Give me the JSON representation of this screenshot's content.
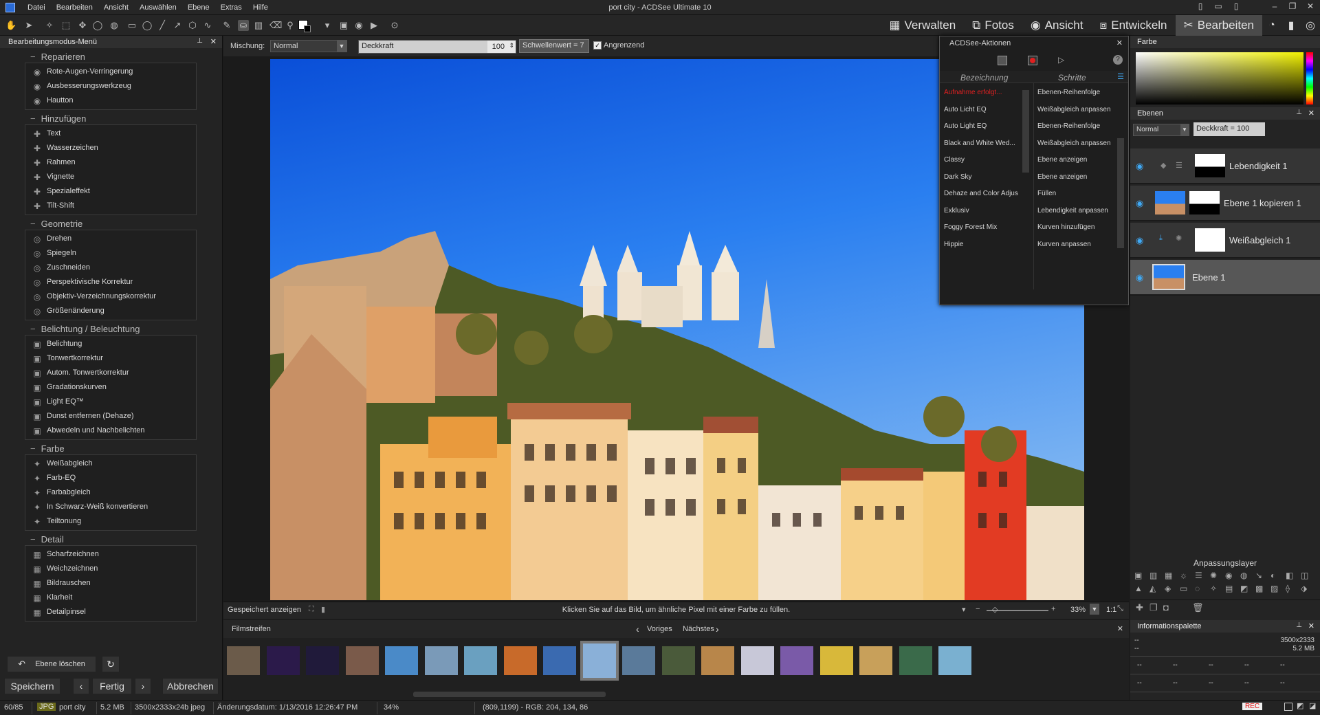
{
  "window": {
    "title": "port city - ACDSee Ultimate 10",
    "menu": [
      "Datei",
      "Bearbeiten",
      "Ansicht",
      "Auswählen",
      "Ebene",
      "Extras",
      "Hilfe"
    ]
  },
  "modes": [
    {
      "label": "Verwalten",
      "icon": "grid-icon"
    },
    {
      "label": "Fotos",
      "icon": "photos-icon"
    },
    {
      "label": "Ansicht",
      "icon": "eye-icon"
    },
    {
      "label": "Entwickeln",
      "icon": "develop-icon"
    },
    {
      "label": "Bearbeiten",
      "icon": "edit-icon",
      "active": true
    }
  ],
  "left_panel": {
    "title": "Bearbeitungsmodus-Menü",
    "groups": [
      {
        "title": "Reparieren",
        "items": [
          "Rote-Augen-Verringerung",
          "Ausbesserungswerkzeug",
          "Hautton"
        ]
      },
      {
        "title": "Hinzufügen",
        "items": [
          "Text",
          "Wasserzeichen",
          "Rahmen",
          "Vignette",
          "Spezialeffekt",
          "Tilt-Shift"
        ]
      },
      {
        "title": "Geometrie",
        "items": [
          "Drehen",
          "Spiegeln",
          "Zuschneiden",
          "Perspektivische Korrektur",
          "Objektiv-Verzeichnungskorrektur",
          "Größenänderung"
        ]
      },
      {
        "title": "Belichtung / Beleuchtung",
        "items": [
          "Belichtung",
          "Tonwertkorrektur",
          "Autom. Tonwertkorrektur",
          "Gradationskurven",
          "Light EQ™",
          "Dunst entfernen (Dehaze)",
          "Abwedeln und Nachbelichten"
        ]
      },
      {
        "title": "Farbe",
        "items": [
          "Weißabgleich",
          "Farb-EQ",
          "Farbabgleich",
          "In Schwarz-Weiß konvertieren",
          "Teiltonung"
        ]
      },
      {
        "title": "Detail",
        "items": [
          "Scharfzeichnen",
          "Weichzeichnen",
          "Bildrauschen",
          "Klarheit",
          "Detailpinsel"
        ]
      }
    ],
    "delete_layer": "Ebene löschen",
    "save": "Speichern",
    "done": "Fertig",
    "cancel": "Abbrechen"
  },
  "options": {
    "blend_label": "Mischung:",
    "blend_value": "Normal",
    "opacity_label": "Deckkraft",
    "opacity_value": "100",
    "threshold": "Schwellenwert = 7",
    "contiguous": "Angrenzend"
  },
  "canvas_bar": {
    "saved": "Gespeichert anzeigen",
    "hint": "Klicken Sie auf das Bild, um ähnliche Pixel mit einer Farbe zu füllen.",
    "zoom": "33%",
    "ratio": "1:1"
  },
  "actions": {
    "title": "ACDSee-Aktionen",
    "col1": "Bezeichnung",
    "col2": "Schritte",
    "names": [
      "Aufnahme erfolgt...",
      "Auto Licht EQ",
      "Auto Light EQ",
      "Black and White Wed...",
      "Classy",
      "Dark Sky",
      "Dehaze and Color Adjus",
      "Exklusiv",
      "Foggy Forest Mix",
      "Hippie"
    ],
    "steps": [
      "Ebenen-Reihenfolge",
      "Weißabgleich anpassen",
      "Ebenen-Reihenfolge",
      "Weißabgleich anpassen",
      "Ebene anzeigen",
      "Ebene anzeigen",
      "Füllen",
      "Lebendigkeit anpassen",
      "Kurven hinzufügen",
      "Kurven anpassen"
    ],
    "recording_color": "#e02020"
  },
  "filmstrip": {
    "title": "Filmstreifen",
    "prev": "Voriges",
    "next": "Nächstes"
  },
  "right_panel": {
    "color_title": "Farbe",
    "layers_title": "Ebenen",
    "blend": "Normal",
    "opacity": "Deckkraft = 100",
    "layers": [
      "Lebendigkeit 1",
      "Ebene 1 kopieren 1",
      "Weißabgleich 1",
      "Ebene 1"
    ],
    "adjust_title": "Anpassungslayer",
    "info_title": "Informationspalette",
    "info_dims": "3500x2333",
    "info_size": "5.2 MB",
    "info_dash": "--"
  },
  "status": {
    "count": "60/85",
    "type": "JPG",
    "name": "port city",
    "size": "5.2 MB",
    "dims": "3500x2333x24b jpeg",
    "date": "Änderungsdatum: 1/13/2016 12:26:47 PM",
    "zoom": "34%",
    "pixel": "(809,1199) - RGB: 204, 134, 86",
    "rec": "REC"
  }
}
